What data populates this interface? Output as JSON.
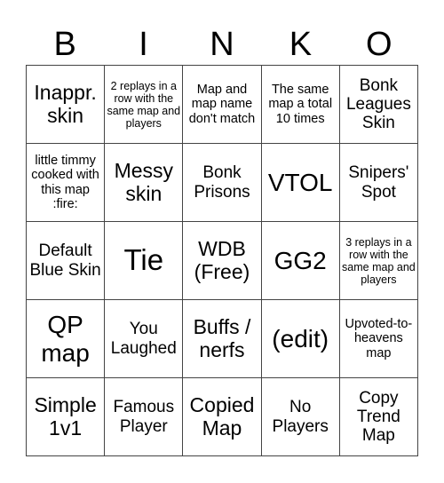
{
  "title_letters": [
    "B",
    "I",
    "N",
    "K",
    "O"
  ],
  "cells": [
    {
      "text": "Inappr. skin",
      "size": "s-lg"
    },
    {
      "text": "2 replays in a row with the same map and players",
      "size": "s-xs"
    },
    {
      "text": "Map and map name don't match",
      "size": "s-sm"
    },
    {
      "text": "The same map a total 10 times",
      "size": "s-sm"
    },
    {
      "text": "Bonk Leagues Skin",
      "size": "s-md"
    },
    {
      "text": "little timmy cooked with this map :fire:",
      "size": "s-sm"
    },
    {
      "text": "Messy skin",
      "size": "s-lg"
    },
    {
      "text": "Bonk Prisons",
      "size": "s-md"
    },
    {
      "text": "VTOL",
      "size": "s-xl"
    },
    {
      "text": "Snipers' Spot",
      "size": "s-md"
    },
    {
      "text": "Default Blue Skin",
      "size": "s-md"
    },
    {
      "text": "Tie",
      "size": "s-xxl"
    },
    {
      "text": "WDB (Free)",
      "size": "s-lg"
    },
    {
      "text": "GG2",
      "size": "s-xl"
    },
    {
      "text": "3 replays in a row with the same map and players",
      "size": "s-xs"
    },
    {
      "text": "QP map",
      "size": "s-xl"
    },
    {
      "text": "You Laughed",
      "size": "s-md"
    },
    {
      "text": "Buffs / nerfs",
      "size": "s-lg"
    },
    {
      "text": "(edit)",
      "size": "s-xl"
    },
    {
      "text": "Upvoted-to-heavens map",
      "size": "s-sm"
    },
    {
      "text": "Simple 1v1",
      "size": "s-lg"
    },
    {
      "text": "Famous Player",
      "size": "s-md"
    },
    {
      "text": "Copied Map",
      "size": "s-lg"
    },
    {
      "text": "No Players",
      "size": "s-md"
    },
    {
      "text": "Copy Trend Map",
      "size": "s-md"
    }
  ]
}
